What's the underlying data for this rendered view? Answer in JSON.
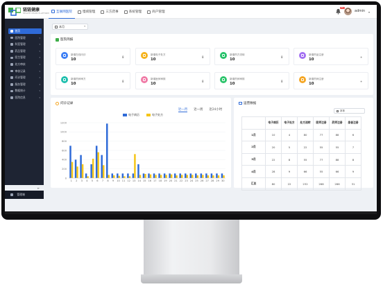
{
  "app": {
    "brand": "链链健康",
    "brand_sub": "HEALTH CHAIN PLATFORM"
  },
  "nav": [
    {
      "label": "互联网医院",
      "icon": "hospital-icon",
      "active": true
    },
    {
      "label": "慢病管理",
      "icon": "heart-icon",
      "active": false
    },
    {
      "label": "三方药事",
      "icon": "pill-icon",
      "active": false
    },
    {
      "label": "系统管理",
      "icon": "gear-icon",
      "active": false
    },
    {
      "label": "商户管理",
      "icon": "shop-icon",
      "active": false
    }
  ],
  "header": {
    "user": "admin",
    "badge": "99+"
  },
  "sidebar": {
    "items": [
      {
        "label": "首页",
        "active": true
      },
      {
        "label": "医院管理"
      },
      {
        "label": "科室管理"
      },
      {
        "label": "药品管理"
      },
      {
        "label": "医生管理"
      },
      {
        "label": "处方审核"
      },
      {
        "label": "审核记录"
      },
      {
        "label": "问诊管理"
      },
      {
        "label": "服务管理"
      },
      {
        "label": "数据统计"
      },
      {
        "label": "医院信息"
      }
    ],
    "bottom": "管理端"
  },
  "filter": {
    "value": "本月"
  },
  "overview": {
    "title": "医院简报",
    "cards": [
      {
        "label": "新增在线问诊",
        "value": "10",
        "num": "8",
        "color": "#3d7ff5"
      },
      {
        "label": "新增电子处方",
        "value": "10",
        "num": "8",
        "color": "#f5b21b"
      },
      {
        "label": "新增药方流转",
        "value": "10",
        "num": "8",
        "color": "#26c26a"
      },
      {
        "label": "新增药品注册",
        "value": "10",
        "num": "+",
        "color": "#a36ff2"
      },
      {
        "label": "新增药师审方",
        "value": "10",
        "num": "8",
        "color": "#1fbfae"
      },
      {
        "label": "新增医师审核",
        "value": "10",
        "num": "8",
        "color": "#f07aa6"
      },
      {
        "label": "新增药师审核",
        "value": "10",
        "num": "8",
        "color": "#2bc46b"
      },
      {
        "label": "新增药师注册",
        "value": "10",
        "num": "+",
        "color": "#f5a623"
      }
    ]
  },
  "records": {
    "title": "问诊记录",
    "tabs": [
      "近一月",
      "近一周",
      "近24小时"
    ],
    "active_tab": 0
  },
  "chart_data": {
    "type": "bar",
    "x": [
      "1",
      "2",
      "3",
      "4",
      "5",
      "6",
      "7",
      "8",
      "9",
      "10",
      "11",
      "12",
      "13",
      "14",
      "15",
      "16",
      "17",
      "18",
      "19",
      "20",
      "21",
      "22",
      "23",
      "24",
      "25",
      "26",
      "27",
      "28",
      "29",
      "30"
    ],
    "series": [
      {
        "name": "电子病历",
        "color": "#2f6bd8",
        "values": [
          700,
          400,
          500,
          100,
          300,
          700,
          500,
          1180,
          100,
          100,
          100,
          100,
          100,
          300,
          100,
          100,
          100,
          100,
          100,
          100,
          100,
          100,
          100,
          100,
          100,
          100,
          100,
          100,
          100,
          100
        ]
      },
      {
        "name": "电子处方",
        "color": "#f5c518",
        "values": [
          350,
          250,
          300,
          40,
          420,
          560,
          280,
          70,
          60,
          50,
          40,
          40,
          520,
          70,
          90,
          80,
          70,
          70,
          70,
          80,
          60,
          70,
          70,
          70,
          60,
          70,
          60,
          60,
          60,
          60
        ]
      }
    ],
    "ylim": [
      0,
      1200
    ],
    "yticks": [
      "0",
      "200",
      "400",
      "600",
      "800",
      "1000",
      "1200"
    ]
  },
  "stats": {
    "title": "运营数据",
    "date": "本年",
    "columns": [
      "",
      "电子病历",
      "电子处方",
      "处方流转",
      "医师注册",
      "药师注册",
      "患者注册"
    ],
    "rows": [
      [
        "1月",
        "10",
        "4",
        "80",
        "77",
        "88",
        "6"
      ],
      [
        "2月",
        "20",
        "5",
        "22",
        "55",
        "55",
        "7"
      ],
      [
        "3月",
        "22",
        "8",
        "55",
        "77",
        "88",
        "8"
      ],
      [
        "4月",
        "28",
        "9",
        "66",
        "55",
        "66",
        "9"
      ],
      [
        "汇总",
        "80",
        "22",
        "232",
        "268",
        "286",
        "31"
      ]
    ]
  }
}
